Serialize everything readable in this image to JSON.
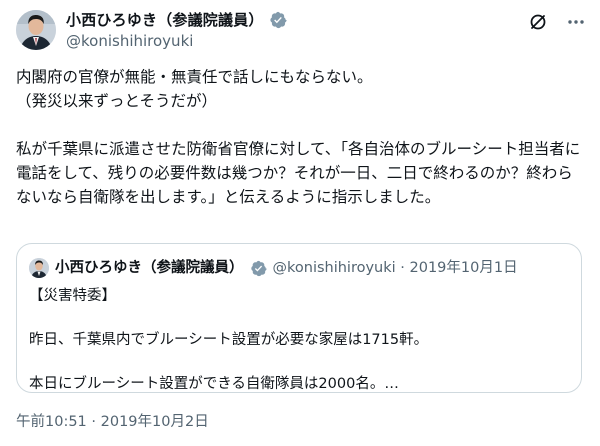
{
  "post": {
    "author": {
      "display_name": "小西ひろゆき（参議院議員）",
      "handle": "@konishihiroyuki",
      "verified_icon": "verified-badge-icon",
      "badge_color": "#829aab"
    },
    "actions": {
      "grok_icon": "grok-icon",
      "more_icon": "more-icon"
    },
    "text": {
      "line1": "内閣府の官僚が無能・無責任で話しにもならない。",
      "line2": "（発災以来ずっとそうだが）",
      "paragraph2": "私が千葉県に派遣させた防衛省官僚に対して、「各自治体のブルーシート担当者に電話をして、残りの必要件数は幾つか？それが一日、二日で終わるのか？終わらないなら自衛隊を出します。」と伝えるように指示しました。"
    },
    "quote": {
      "display_name": "小西ひろゆき（参議院議員）",
      "meta": "@konishihiroyuki · 2019年10月1日",
      "line1": "【災害特委】",
      "line2": "昨日、千葉県内でブルーシート設置が必要な家屋は1715軒。",
      "line3": "本日にブルーシート設置ができる自衛隊員は2000名。…"
    },
    "timestamp": "午前10:51 · 2019年10月2日"
  }
}
